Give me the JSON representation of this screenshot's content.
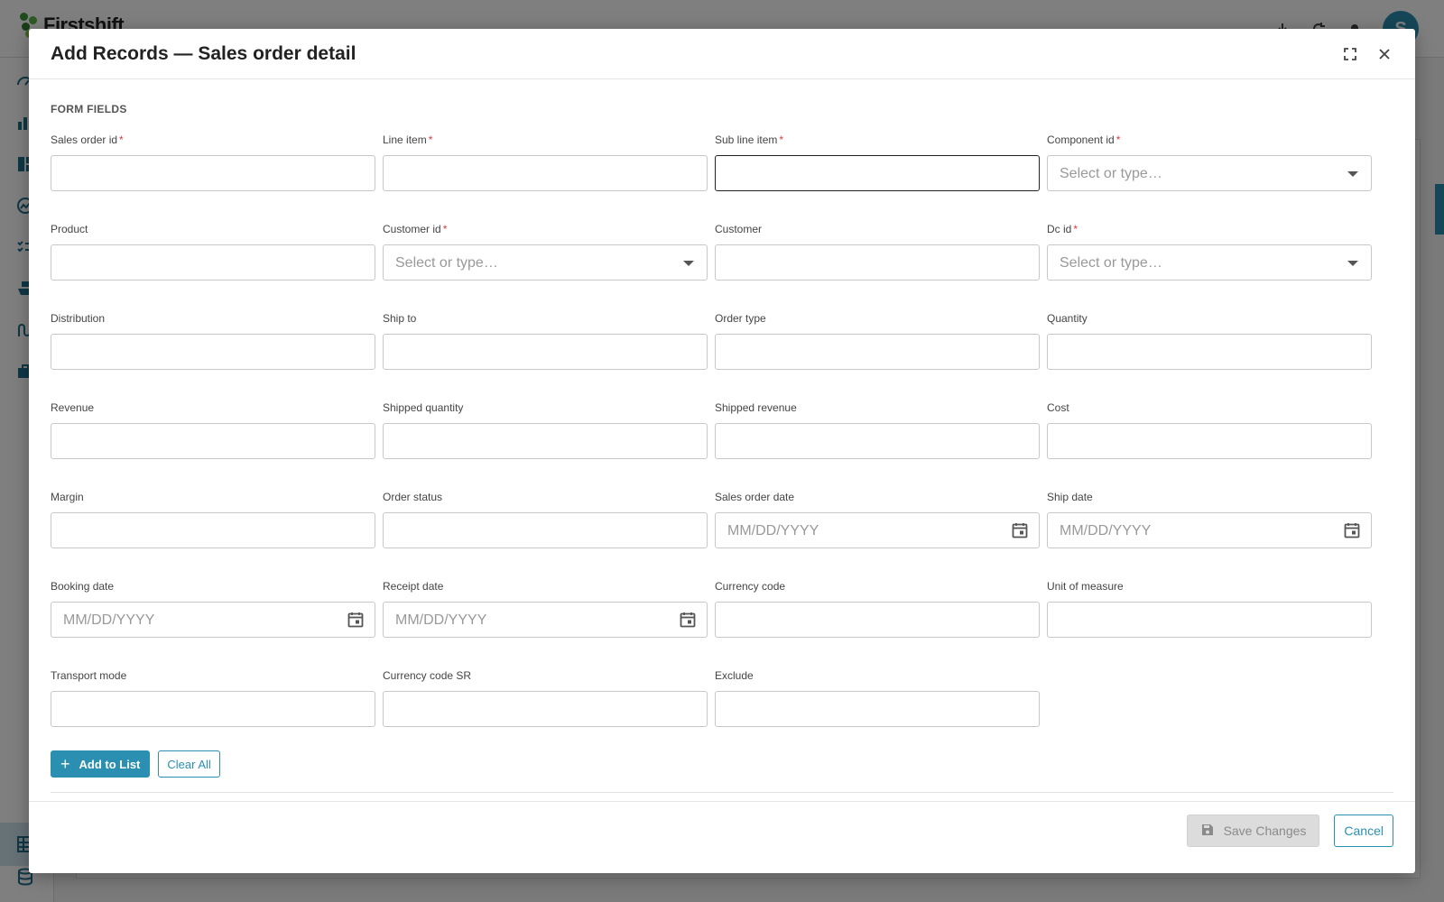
{
  "app": {
    "logo_text": "Firstshift",
    "avatar_initial": "S"
  },
  "modal": {
    "title": "Add Records — Sales order detail",
    "section_title": "FORM FIELDS",
    "required_mark": "*",
    "add_button": "Add to List",
    "add_icon": "+",
    "clear_button": "Clear All",
    "save_button": "Save Changes",
    "cancel_button": "Cancel"
  },
  "fields": {
    "sales_order_id": {
      "label": "Sales order id"
    },
    "line_item": {
      "label": "Line item"
    },
    "sub_line_item": {
      "label": "Sub line item"
    },
    "component_id": {
      "label": "Component id",
      "placeholder": "Select or type…"
    },
    "product": {
      "label": "Product"
    },
    "customer_id": {
      "label": "Customer id",
      "placeholder": "Select or type…"
    },
    "customer": {
      "label": "Customer"
    },
    "dc_id": {
      "label": "Dc id",
      "placeholder": "Select or type…"
    },
    "distribution": {
      "label": "Distribution"
    },
    "ship_to": {
      "label": "Ship to"
    },
    "order_type": {
      "label": "Order type"
    },
    "quantity": {
      "label": "Quantity"
    },
    "revenue": {
      "label": "Revenue"
    },
    "shipped_quantity": {
      "label": "Shipped quantity"
    },
    "shipped_revenue": {
      "label": "Shipped revenue"
    },
    "cost": {
      "label": "Cost"
    },
    "margin": {
      "label": "Margin"
    },
    "order_status": {
      "label": "Order status"
    },
    "sales_order_date": {
      "label": "Sales order date",
      "placeholder": "MM/DD/YYYY"
    },
    "ship_date": {
      "label": "Ship date",
      "placeholder": "MM/DD/YYYY"
    },
    "booking_date": {
      "label": "Booking date",
      "placeholder": "MM/DD/YYYY"
    },
    "receipt_date": {
      "label": "Receipt date",
      "placeholder": "MM/DD/YYYY"
    },
    "currency_code": {
      "label": "Currency code"
    },
    "unit_of_measure": {
      "label": "Unit of measure"
    },
    "transport_mode": {
      "label": "Transport mode"
    },
    "currency_code_sr": {
      "label": "Currency code SR"
    },
    "exclude": {
      "label": "Exclude"
    }
  }
}
